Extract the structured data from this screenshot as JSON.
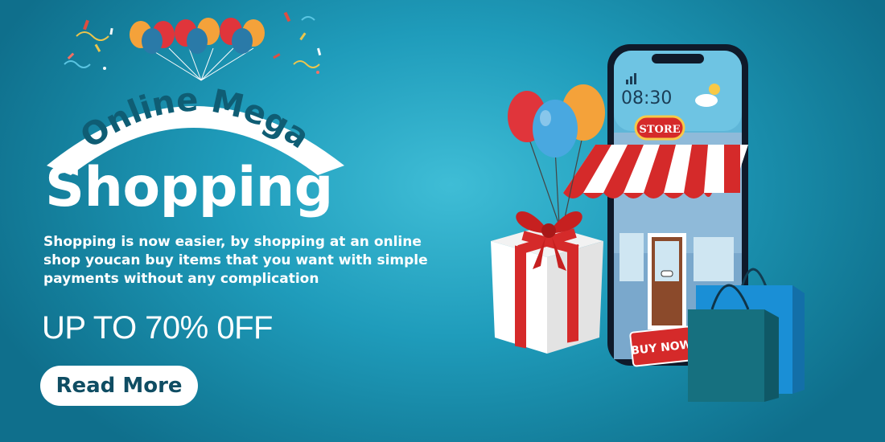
{
  "banner": {
    "arc_text": "Online Mega",
    "headline": "Shopping",
    "description": "Shopping is now easier, by shopping at an online shop youcan buy items that you want with simple payments without any complication",
    "offer": "UP TO 70% 0FF",
    "cta_label": "Read More"
  },
  "phone": {
    "time": "08:30",
    "store_sign": "STORE",
    "buy_now_sign": "BUY NOW"
  },
  "colors": {
    "background": "#1f9cbb",
    "headline_text": "#ffffff",
    "arc_text": "#0f5d74",
    "button_text": "#0f4d63",
    "accent_red": "#d52a2a",
    "balloon_red": "#e0353b",
    "balloon_blue": "#49a8e0",
    "balloon_orange": "#f4a23a"
  },
  "icons": [
    "confetti-icon",
    "balloon-cluster-icon",
    "phone-store-illustration",
    "gift-box-icon",
    "shopping-bag-icon",
    "weather-icon",
    "signal-icon"
  ]
}
